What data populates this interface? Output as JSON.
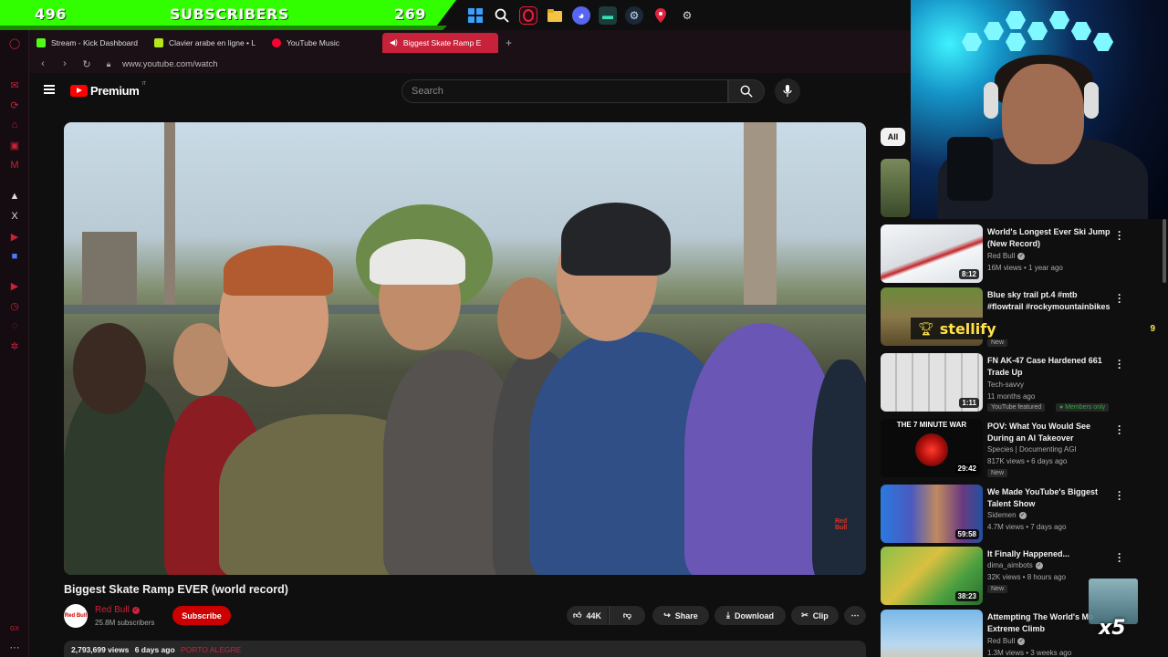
{
  "stream_bar": {
    "left_count": "496",
    "label": "SUBSCRIBERS",
    "right_count": "269"
  },
  "tabs": [
    {
      "label": "Stream - Kick Dashboard",
      "color": "#53fc18",
      "active": false
    },
    {
      "label": "Clavier arabe en ligne • L",
      "color": "#b5e61d",
      "active": false
    },
    {
      "label": "YouTube Music",
      "color": "#ff0033",
      "active": false
    },
    {
      "label": "Biggest Skate Ramp E",
      "color": "#ffffff",
      "active": true
    }
  ],
  "address": {
    "url": "www.youtube.com/watch"
  },
  "youtube": {
    "logo_text": "Premium",
    "logo_sup": "IT",
    "search_placeholder": "Search"
  },
  "video": {
    "title": "Biggest Skate Ramp EVER (world record)",
    "channel": "Red Bull",
    "subscribers": "25.8M subscribers",
    "subscribe_label": "Subscribe",
    "likes": "44K",
    "share_label": "Share",
    "download_label": "Download",
    "clip_label": "Clip",
    "views": "2,793,699 views",
    "age": "6 days ago",
    "location": "PORTO ALEGRE"
  },
  "filter_chip": "All",
  "recommendations": [
    {
      "title": "World's Longest Ever Ski Jump (New Record)",
      "channel": "Red Bull",
      "verified": true,
      "meta": "16M views • 1 year ago",
      "duration": "8:12",
      "badges": []
    },
    {
      "title": "Blue sky trail pt.4 #mtb #flowtrail #rockymountainbikes",
      "channel": "",
      "verified": false,
      "meta": "",
      "duration": "",
      "badges": [
        "New"
      ]
    },
    {
      "title": "FN AK-47 Case Hardened 661 Trade Up",
      "channel": "Tech-savvy",
      "verified": false,
      "meta": "11 months ago",
      "duration": "1:11",
      "badges": [
        "YouTube featured",
        "Members only"
      ]
    },
    {
      "title": "POV: What You Would See During an AI Takeover",
      "channel": "Species | Documenting AGI",
      "verified": false,
      "meta": "817K views • 6 days ago",
      "duration": "29:42",
      "thumb_text": "THE 7 MINUTE WAR",
      "badges": [
        "New"
      ]
    },
    {
      "title": "We Made YouTube's Biggest Talent Show",
      "channel": "Sidemen",
      "verified": true,
      "meta": "4.7M views • 7 days ago",
      "duration": "59:58",
      "badges": []
    },
    {
      "title": "It Finally Happened...",
      "channel": "dima_aimbots",
      "verified": true,
      "meta": "32K views • 8 hours ago",
      "duration": "38:23",
      "badges": [
        "New"
      ]
    },
    {
      "title": "Attempting The World's Mo Extreme Climb",
      "channel": "Red Bull",
      "verified": true,
      "meta": "1.3M views • 3 weeks ago",
      "duration": "",
      "badges": []
    }
  ],
  "overlay": {
    "stellify_name": "stellify",
    "stellify_count": "9",
    "multiplier": "x5"
  }
}
